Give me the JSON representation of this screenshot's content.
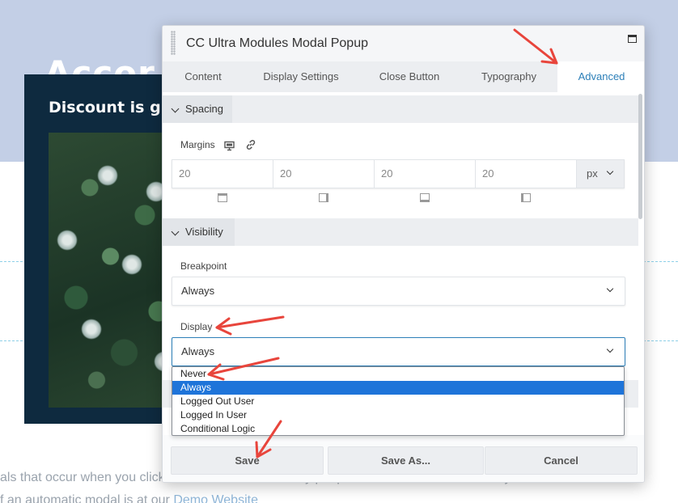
{
  "background": {
    "heading": "Accor",
    "promo_title": "Discount is g",
    "body_line1": "als that occur when you click on a button or text. Many people use modal to automatically occur whe",
    "body_line2_prefix": "f an automatic modal is at our ",
    "body_line2_link": "Demo Website"
  },
  "modal": {
    "title": "CC Ultra Modules Modal Popup",
    "tabs": [
      "Content",
      "Display Settings",
      "Close Button",
      "Typography",
      "Advanced"
    ],
    "active_tab": "Advanced",
    "spacing": {
      "section_label": "Spacing",
      "margins_label": "Margins",
      "margin_values": [
        "20",
        "20",
        "20",
        "20"
      ],
      "unit": "px"
    },
    "visibility": {
      "section_label": "Visibility",
      "breakpoint_label": "Breakpoint",
      "breakpoint_value": "Always",
      "display_label": "Display",
      "display_value": "Always",
      "display_options": [
        "Never",
        "Always",
        "Logged Out User",
        "Logged In User",
        "Conditional Logic"
      ],
      "selected_option": "Always"
    },
    "buttons": {
      "save": "Save",
      "save_as": "Save As...",
      "cancel": "Cancel"
    }
  },
  "colors": {
    "accent": "#2c7fb8",
    "selected_option": "#1e74d9",
    "annotation": "#e8453c",
    "header_bg": "#c3cfe6",
    "promo_bg": "#0e2a3f"
  },
  "icons": [
    "drag-handle-icon",
    "maximize-icon",
    "chevron-down-icon",
    "monitor-icon",
    "link-icon",
    "side-top-icon",
    "side-right-icon",
    "side-bottom-icon",
    "side-left-icon"
  ]
}
